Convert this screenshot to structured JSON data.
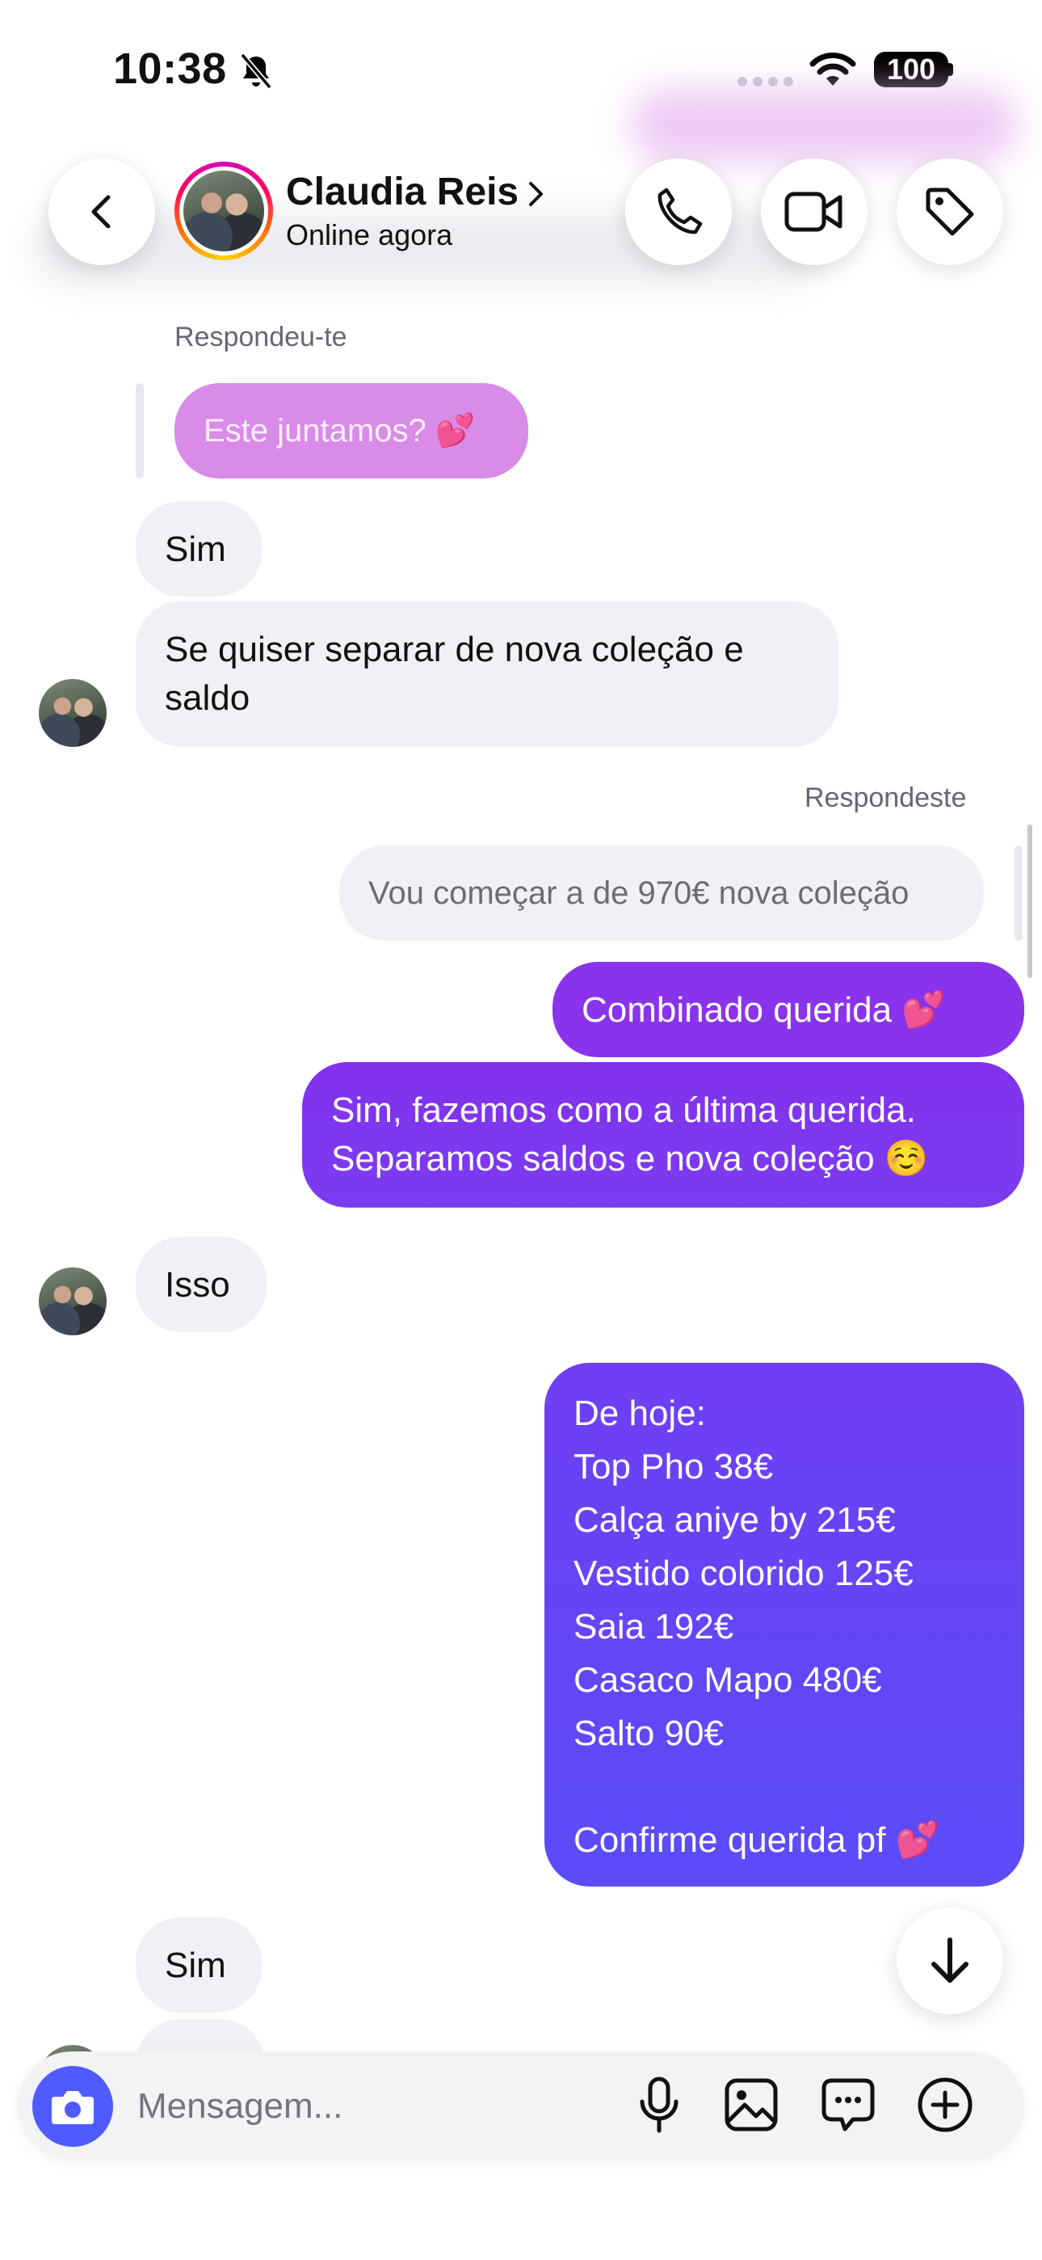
{
  "status_bar": {
    "time": "10:38",
    "battery": "100"
  },
  "header": {
    "name": "Claudia Reis",
    "status": "Online agora"
  },
  "messages": {
    "replied_to_you": "Respondeu-te",
    "quoted_in": "Este juntamos? 💕",
    "in1": "Sim",
    "in2": "Se quiser separar de nova coleção e saldo",
    "you_replied": "Respondeste",
    "quoted_out": "Vou começar a de 970€ nova coleção",
    "out1": "Combinado querida 💕",
    "out2_line1": "Sim, fazemos como a última querida.",
    "out2_line2": "Separamos saldos e nova coleção ☺️",
    "in3": "Isso",
    "out3_lines": [
      "De hoje:",
      "Top Pho 38€",
      "Calça aniye by 215€",
      "Vestido colorido 125€",
      "Saia 192€",
      "Casaco Mapo 480€",
      "Salto 90€",
      "",
      "Confirme querida pf 💕"
    ],
    "in4": "Sim",
    "in5_partial": "I"
  },
  "composer": {
    "placeholder": "Mensagem..."
  },
  "colors": {
    "incoming_bubble": "#eff1f4",
    "quoted_pink": "#d98be8",
    "outgoing_purple": "#7b3cf0",
    "outgoing_indigo": "#5b4cf8",
    "camera_button": "#4f5bff"
  },
  "icons": {
    "back": "chevron-left-icon",
    "call": "phone-icon",
    "video": "video-camera-icon",
    "tag": "tag-icon",
    "scroll_down": "arrow-down-icon",
    "camera": "camera-icon",
    "mic": "microphone-icon",
    "gallery": "image-icon",
    "sticker": "chat-bubble-icon",
    "more": "plus-circle-icon"
  }
}
